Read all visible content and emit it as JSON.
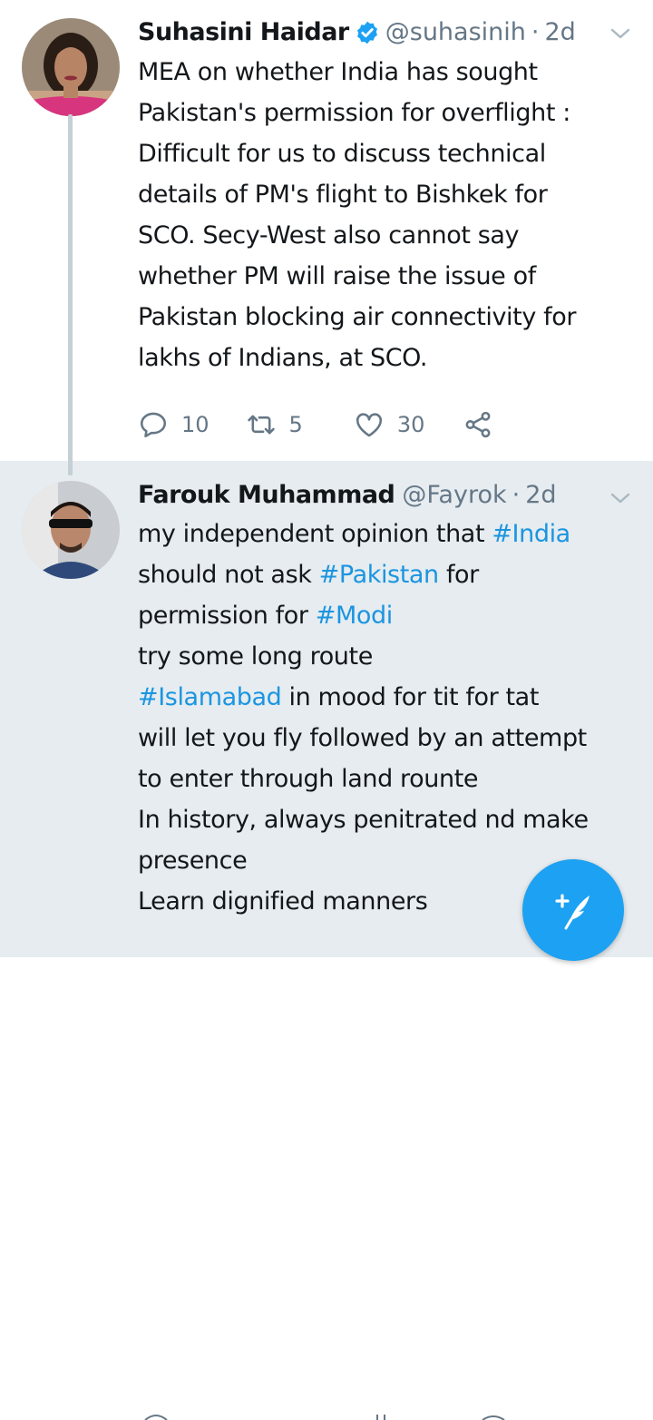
{
  "tweets": [
    {
      "name": "Suhasini Haidar",
      "handle": "@suhasinih",
      "time": "2d",
      "verified": true,
      "lines": [
        "MEA on whether India has sought",
        "Pakistan's permission for overflight :",
        "Difficult for us to discuss technical",
        "details of PM's flight to Bishkek for",
        "SCO. Secy-West also  cannot say",
        "whether PM will raise the issue of",
        "Pakistan blocking air connectivity for",
        "lakhs of Indians, at SCO."
      ],
      "replies": "10",
      "retweets": "5",
      "likes": "30"
    },
    {
      "name": "Farouk Muhammad",
      "handle": "@Fayrok",
      "time": "2d",
      "verified": false,
      "text": {
        "l1_plain": "my independent opinion that ",
        "l1_tag": "#India",
        "l2_plain1": "should not ask ",
        "l2_tag": "#Pakistan",
        "l2_plain2": " for",
        "l3_plain": "permission for ",
        "l3_tag": "#Modi",
        "l4": "try some long route",
        "l5_tag": "#Islamabad",
        "l5_plain": " in mood for tit for tat",
        "l6": "will let you fly followed by an attempt",
        "l7": "to enter through land rounte",
        "l8": "In history, always penitrated nd make",
        "l9": "presence",
        "l10": "Learn dignified manners"
      }
    }
  ],
  "colors": {
    "link": "#1b95e0",
    "secondary": "#657786",
    "highlight_bg": "#e6ecf0",
    "fab": "#1da1f2"
  },
  "icons": [
    "verified-badge-icon",
    "chevron-down-icon",
    "reply-icon",
    "retweet-icon",
    "like-icon",
    "share-icon",
    "compose-tweet-icon"
  ]
}
